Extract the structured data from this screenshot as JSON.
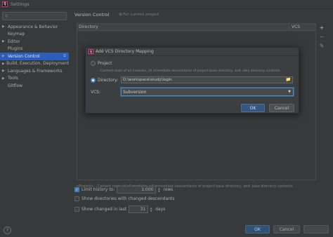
{
  "window": {
    "title": "Settings",
    "app_icon": "IJ"
  },
  "search": {
    "placeholder": ""
  },
  "sidebar": {
    "items": [
      {
        "label": "Appearance & Behavior",
        "expandable": true
      },
      {
        "label": "Keymap",
        "expandable": false
      },
      {
        "label": "Editor",
        "expandable": true
      },
      {
        "label": "Plugins",
        "expandable": false
      },
      {
        "label": "Version Control",
        "expandable": true,
        "selected": true
      },
      {
        "label": "Build, Execution, Deployment",
        "expandable": true
      },
      {
        "label": "Languages & Frameworks",
        "expandable": true
      },
      {
        "label": "Tools",
        "expandable": true
      },
      {
        "label": "Gitflow",
        "expandable": false
      }
    ]
  },
  "main": {
    "title": "Version Control",
    "subtitle": "For current project",
    "table": {
      "columns": [
        "Directory",
        "VCS"
      ]
    },
    "hint": "<Project> - Content roots of all modules, all immediate descendants of project base directory, and .idea directory contents",
    "limit_history": {
      "label": "Limit history to:",
      "value": "1,000",
      "unit": "rows",
      "checked": true
    },
    "show_dirs": {
      "label": "Show directories with changed descendants",
      "checked": false
    },
    "show_changed": {
      "label": "Show changed in last",
      "value": "31",
      "unit": "days",
      "checked": false
    }
  },
  "footer": {
    "ok": "OK",
    "cancel": "Cancel",
    "help": "?"
  },
  "dialog": {
    "title": "Add VCS Directory Mapping",
    "project_label": "Project",
    "project_desc": "Content roots of all modules, all immediate descendants of project base directory, and .idea directory contents",
    "directory_label": "Directory:",
    "directory_value": "D:\\workspace\\study\\login",
    "vcs_label": "VCS:",
    "vcs_value": "Subversion",
    "ok": "OK",
    "cancel": "Cancel"
  },
  "colors": {
    "selection": "#2f65ca",
    "accent": "#4a88c7",
    "background": "#3c3f41"
  }
}
